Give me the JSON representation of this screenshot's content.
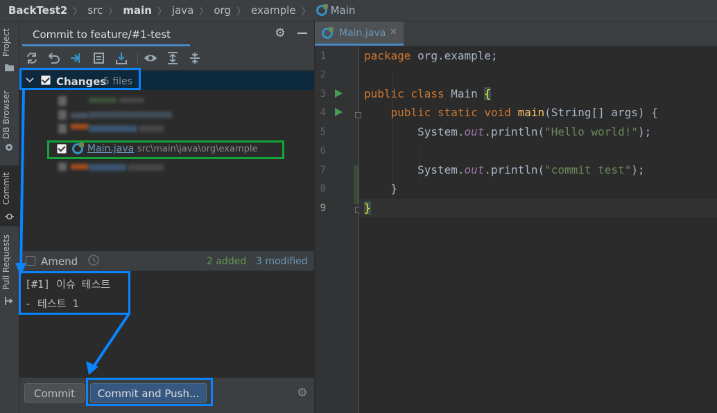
{
  "breadcrumb": {
    "items": [
      {
        "label": "BackTest2",
        "style": "bold"
      },
      {
        "label": "src",
        "style": "normal"
      },
      {
        "label": "main",
        "style": "bold"
      },
      {
        "label": "java",
        "style": "normal"
      },
      {
        "label": "org",
        "style": "normal"
      },
      {
        "label": "example",
        "style": "normal"
      },
      {
        "label": "Main",
        "style": "active",
        "icon": "class-icon"
      }
    ]
  },
  "tool_strip": {
    "tabs": [
      {
        "label": "Project",
        "icon": "folder-icon"
      },
      {
        "label": "DB Browser",
        "icon": "db-icon"
      },
      {
        "label": "Commit",
        "icon": "commit-icon"
      },
      {
        "label": "Pull Requests",
        "icon": "pull-request-icon"
      }
    ]
  },
  "commit_panel": {
    "title": "Commit to feature/#1-test",
    "toolbar_icons": [
      "refresh-icon",
      "rollback-icon",
      "update-icon",
      "show-diff-icon",
      "shelve-icon",
      "view-options-icon",
      "expand-all-icon",
      "collapse-all-icon"
    ],
    "changes_group": {
      "label": "Changes",
      "count": "5 files",
      "checked": true
    },
    "selected_file": {
      "name": "Main.java",
      "path": "src\\main\\java\\org\\example",
      "checked": true
    },
    "amend": {
      "label": "Amend",
      "checked": false
    },
    "stats": {
      "added": "2 added",
      "modified": "3 modified"
    },
    "message": {
      "line1": "[#1] 이슈 테스트",
      "line2": "- 테스트 1"
    },
    "buttons": {
      "commit": "Commit",
      "commit_and_push": "Commit and Push..."
    }
  },
  "editor": {
    "tab": {
      "label": "Main.java",
      "close": "✕"
    },
    "line_numbers": [
      "1",
      "2",
      "3",
      "4",
      "5",
      "6",
      "7",
      "8",
      "9"
    ],
    "code": {
      "l1": {
        "kw": "package",
        "rest": " org.example;"
      },
      "l3": {
        "kw": "public class",
        "name": " Main ",
        "brace": "{"
      },
      "l4": {
        "indent": "    ",
        "kw": "public static void",
        "fn": "main",
        "rest": "(String[] args) {"
      },
      "l5": {
        "indent": "        ",
        "obj": "System.",
        "field": "out",
        "call": ".println(",
        "str": "\"Hello world!\"",
        "end": ");"
      },
      "l7": {
        "indent": "        ",
        "obj": "System.",
        "field": "out",
        "call": ".println(",
        "str": "\"commit test\"",
        "end": ");"
      },
      "l8": {
        "text": "    }"
      },
      "l9": {
        "brace": "}"
      }
    }
  },
  "colors": {
    "annotation_blue": "#0a84ff",
    "annotation_green": "#13a538",
    "selection_dark_blue": "#0d293e",
    "accent_blue": "#4a88c7"
  }
}
